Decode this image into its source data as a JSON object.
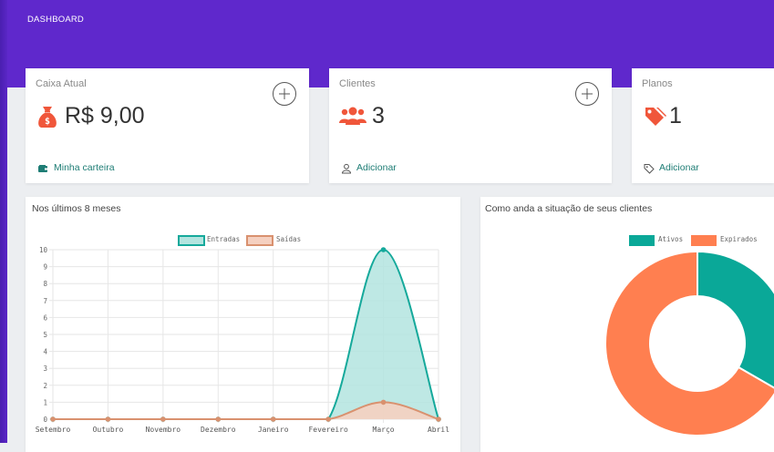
{
  "header": {
    "title": "DASHBOARD"
  },
  "cards": {
    "caixa": {
      "title": "Caixa Atual",
      "value": "R$ 9,00",
      "link": "Minha carteira",
      "icon": "money-bag-icon"
    },
    "clientes": {
      "title": "Clientes",
      "value": "3",
      "link": "Adicionar",
      "icon": "users-icon"
    },
    "planos": {
      "title": "Planos",
      "value": "1",
      "link": "Adicionar",
      "icon": "tags-icon"
    }
  },
  "colors": {
    "header": "#5f28cc",
    "accent_red": "#f0563a",
    "teal": "#15a99b",
    "orange": "#ff7f50",
    "link": "#1e7d75"
  },
  "line_chart": {
    "title": "Nos últimos 8 meses"
  },
  "donut_chart": {
    "title": "Como anda a situação de seus clientes"
  },
  "chart_data": [
    {
      "type": "area",
      "title": "",
      "xlabel": "",
      "ylabel": "",
      "categories": [
        "Setembro",
        "Outubro",
        "Novembro",
        "Dezembro",
        "Janeiro",
        "Fevereiro",
        "Março",
        "Abril"
      ],
      "ylim": [
        0,
        10
      ],
      "yticks": [
        "0",
        "1",
        "2",
        "3",
        "4",
        "5",
        "6",
        "7",
        "8",
        "9",
        "10"
      ],
      "grid": true,
      "legend": "top-center",
      "series": [
        {
          "name": "Entradas",
          "values": [
            0,
            0,
            0,
            0,
            0,
            0,
            10,
            0
          ],
          "color": "#15a99b",
          "fill": "#b3e4df"
        },
        {
          "name": "Saídas",
          "values": [
            0,
            0,
            0,
            0,
            0,
            0,
            1,
            0
          ],
          "color": "#d9916f",
          "fill": "#f5d0c0"
        }
      ]
    },
    {
      "type": "pie",
      "title": "",
      "legend": "top-right",
      "categories": [
        "Ativos",
        "Expirados"
      ],
      "values": [
        1,
        2
      ],
      "colors": [
        "#0aa898",
        "#ff7f50"
      ]
    }
  ]
}
